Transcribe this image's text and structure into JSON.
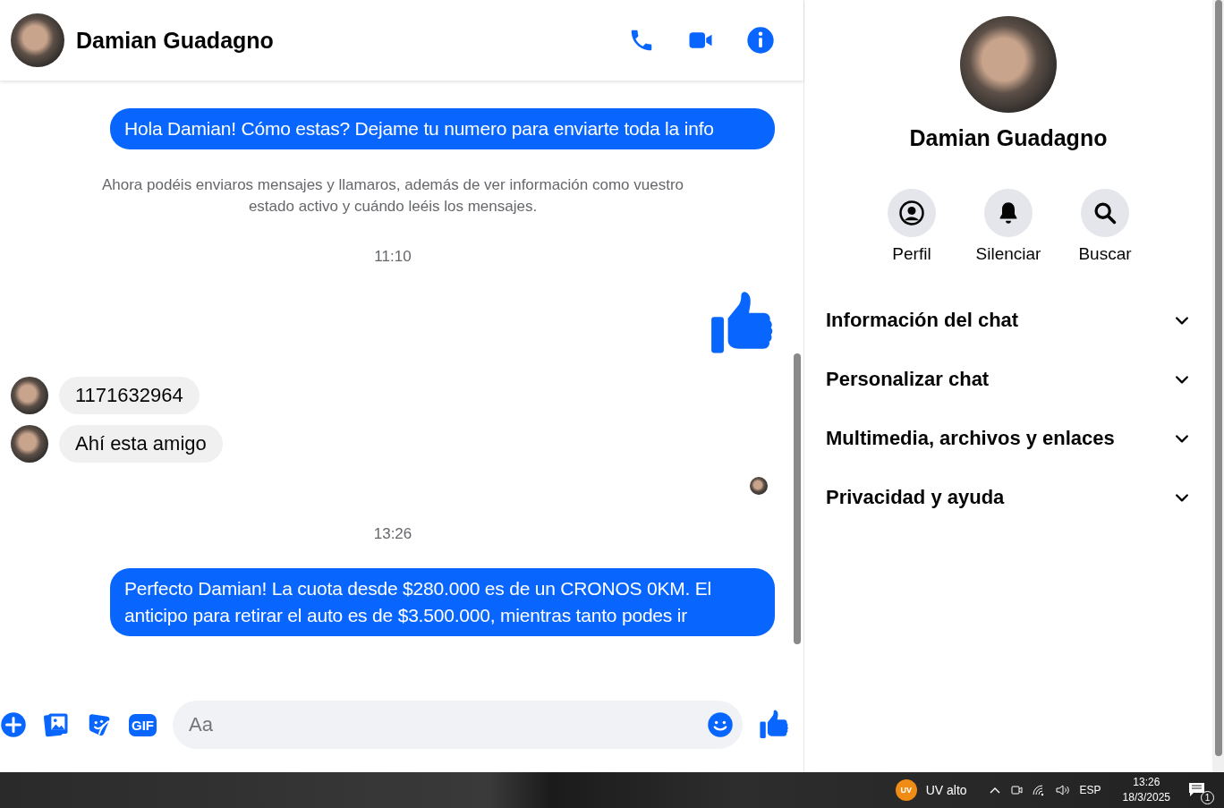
{
  "chat": {
    "contact_name": "Damian Guadagno",
    "messages": [
      {
        "kind": "outgoing",
        "text": "Hola Damian! Cómo estas? Dejame tu numero para enviarte toda la info"
      },
      {
        "kind": "notice",
        "text": "Ahora podéis enviaros mensajes y llamaros, además de ver información como vuestro estado activo y cuándo leéis los mensajes."
      },
      {
        "kind": "time",
        "text": "11:10"
      },
      {
        "kind": "like"
      },
      {
        "kind": "incoming",
        "text": "1171632964"
      },
      {
        "kind": "incoming",
        "text": "Ahí esta amigo"
      },
      {
        "kind": "seen"
      },
      {
        "kind": "time",
        "text": "13:26"
      },
      {
        "kind": "outgoing",
        "text": "Perfecto Damian! La cuota desde $280.000 es de un CRONOS 0KM. El anticipo para retirar el auto es de $3.500.000, mientras tanto podes ir"
      }
    ],
    "composer": {
      "gif_label": "GIF",
      "placeholder": "Aa"
    }
  },
  "sidebar": {
    "name": "Damian Guadagno",
    "actions": [
      {
        "label": "Perfil",
        "kind": "profile"
      },
      {
        "label": "Silenciar",
        "kind": "mute"
      },
      {
        "label": "Buscar",
        "kind": "search"
      }
    ],
    "sections": [
      {
        "label": "Información del chat",
        "expanded": false
      },
      {
        "label": "Personalizar chat",
        "expanded": false
      },
      {
        "label": "Multimedia, archivos y enlaces",
        "expanded": false
      },
      {
        "label": "Privacidad y ayuda",
        "expanded": false
      }
    ]
  },
  "taskbar": {
    "uv_badge": "UV",
    "weather": "UV alto",
    "language": "ESP",
    "time": "13:26",
    "date": "18/3/2025",
    "notifications": "1"
  }
}
